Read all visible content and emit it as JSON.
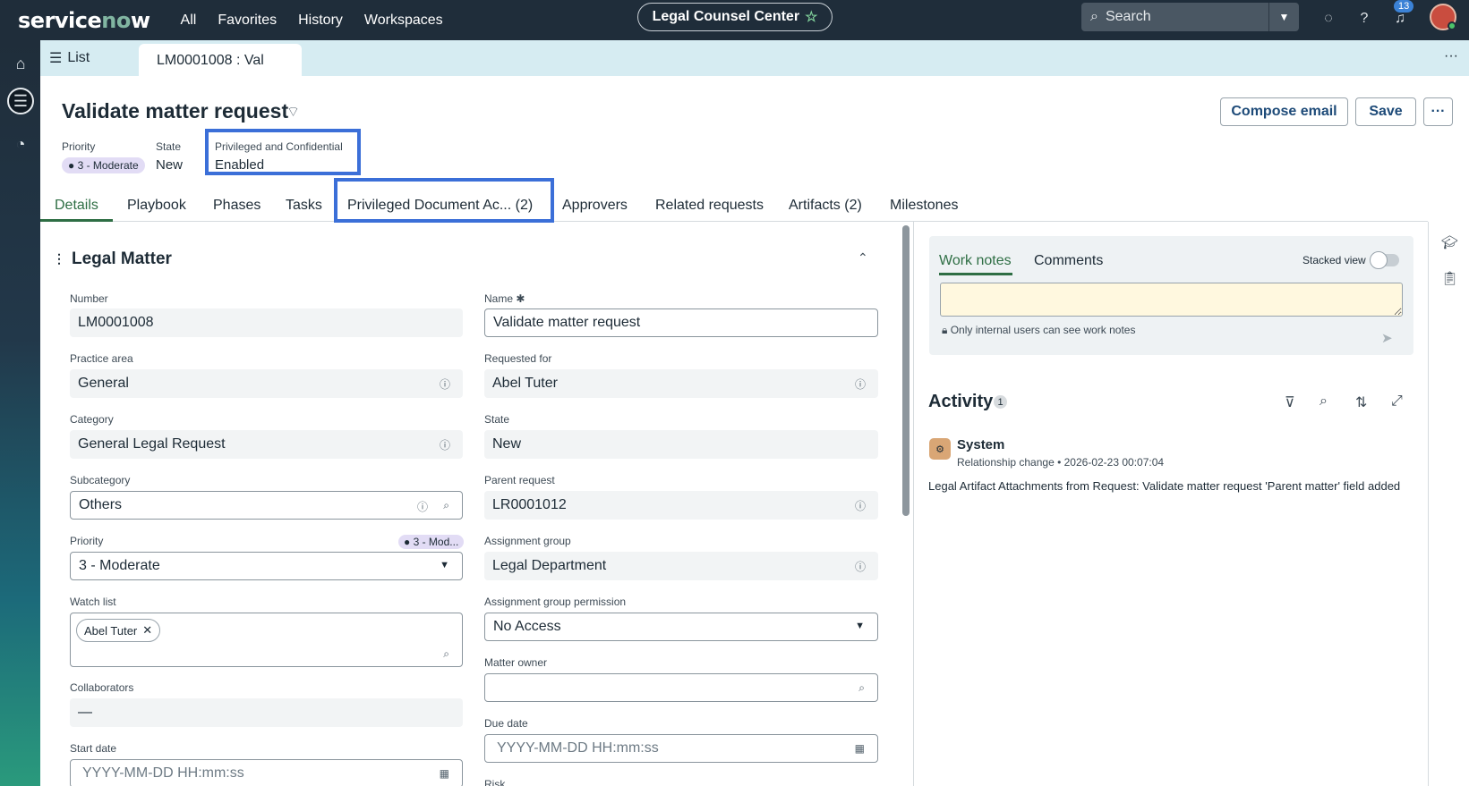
{
  "topbar": {
    "logo": "servicenow",
    "nav": [
      "All",
      "Favorites",
      "History",
      "Workspaces"
    ],
    "workspace_name": "Legal Counsel Center",
    "search_placeholder": "Search",
    "notification_count": "13"
  },
  "tabs": {
    "list_label": "List",
    "active_tab": "LM0001008 : Val"
  },
  "record": {
    "title": "Validate matter request",
    "priority_label": "Priority",
    "priority_value": "3 - Moderate",
    "state_label": "State",
    "state_value": "New",
    "privileged_label": "Privileged and Confidential",
    "privileged_value": "Enabled",
    "compose_email": "Compose email",
    "save": "Save",
    "more": "···"
  },
  "form_tabs": [
    "Details",
    "Playbook",
    "Phases",
    "Tasks",
    "Privileged Document Ac...   (2)",
    "Approvers",
    "Related requests",
    "Artifacts (2)",
    "Milestones"
  ],
  "section_title": "Legal Matter",
  "fields": {
    "number": {
      "label": "Number",
      "value": "LM0001008"
    },
    "name": {
      "label": "Name",
      "value": "Validate matter request"
    },
    "practice_area": {
      "label": "Practice area",
      "value": "General"
    },
    "requested_for": {
      "label": "Requested for",
      "value": "Abel Tuter"
    },
    "category": {
      "label": "Category",
      "value": "General Legal Request"
    },
    "state": {
      "label": "State",
      "value": "New"
    },
    "subcategory": {
      "label": "Subcategory",
      "value": "Others"
    },
    "parent_request": {
      "label": "Parent request",
      "value": "LR0001012"
    },
    "priority": {
      "label": "Priority",
      "value": "3 - Moderate",
      "pill": "3 - Mod..."
    },
    "assignment_group": {
      "label": "Assignment group",
      "value": "Legal Department"
    },
    "watch_list": {
      "label": "Watch list",
      "chip": "Abel Tuter"
    },
    "assignment_group_permission": {
      "label": "Assignment group permission",
      "value": "No Access"
    },
    "matter_owner": {
      "label": "Matter owner",
      "value": ""
    },
    "collaborators": {
      "label": "Collaborators",
      "value": "—"
    },
    "due_date": {
      "label": "Due date",
      "placeholder": "YYYY-MM-DD HH:mm:ss"
    },
    "start_date": {
      "label": "Start date",
      "placeholder": "YYYY-MM-DD HH:mm:ss"
    },
    "risk": {
      "label": "Risk"
    }
  },
  "notes": {
    "work_notes_tab": "Work notes",
    "comments_tab": "Comments",
    "stacked_view": "Stacked view",
    "internal_note": "Only internal users can see work notes"
  },
  "activity": {
    "title": "Activity",
    "count": "1",
    "entry_author": "System",
    "entry_type": "Relationship change",
    "entry_time": "2026-02-23 00:07:04",
    "entry_text": "Legal Artifact Attachments from Request: Validate matter request 'Parent matter' field added"
  }
}
